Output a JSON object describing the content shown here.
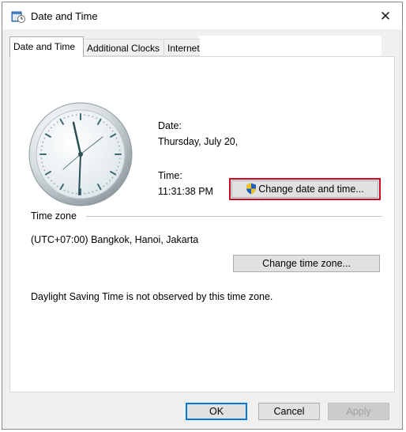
{
  "window": {
    "title": "Date and Time",
    "close_glyph": "✕"
  },
  "tabs": [
    {
      "label": "Date and Time",
      "active": true
    },
    {
      "label": "Additional Clocks",
      "active": false
    },
    {
      "label": "Internet Time",
      "active": false
    }
  ],
  "datetime": {
    "date_label": "Date:",
    "date_value": "Thursday, July 20,",
    "time_label": "Time:",
    "time_value": "11:31:38 PM",
    "change_button": "Change date and time..."
  },
  "timezone": {
    "section_label": "Time zone",
    "value": "(UTC+07:00) Bangkok, Hanoi, Jakarta",
    "change_button": "Change time zone...",
    "dst_note": "Daylight Saving Time is not observed by this time zone."
  },
  "buttons": {
    "ok": "OK",
    "cancel": "Cancel",
    "apply": "Apply"
  },
  "icons": {
    "title": "date-time-control-panel-icon",
    "shield": "uac-shield-icon",
    "close": "close-icon"
  },
  "colors": {
    "highlight": "#d0021b",
    "default_button_border": "#0078d7"
  }
}
